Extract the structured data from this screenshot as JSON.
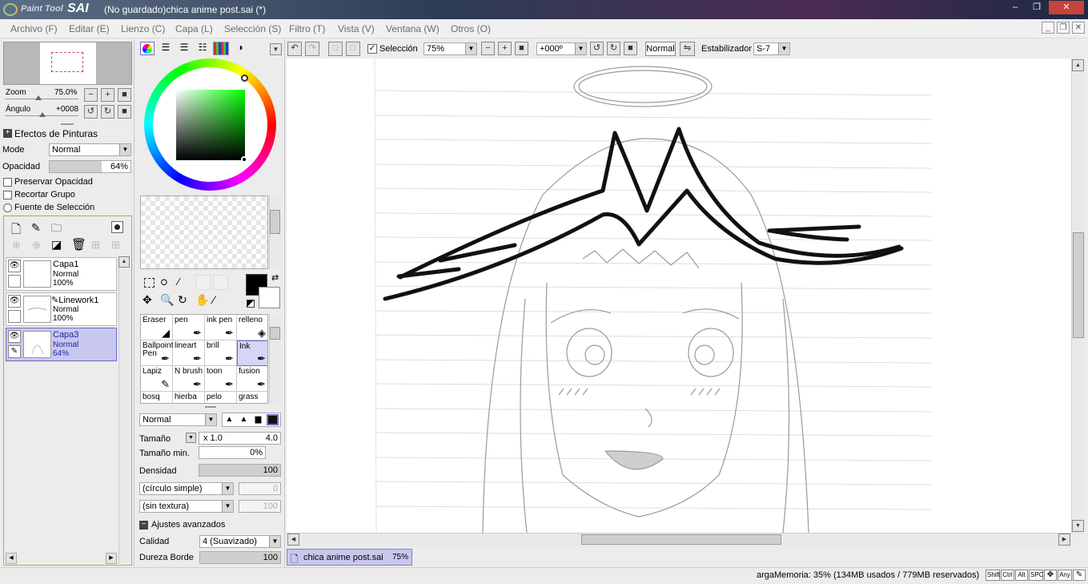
{
  "app": {
    "logo_small": "Paint Tool",
    "logo_big": "SAI",
    "title": "(No guardado)chica anime post.sai (*)"
  },
  "window_controls": {
    "minimize": "–",
    "restore": "❐",
    "close": "✕"
  },
  "menu": [
    "Archivo (F)",
    "Editar (E)",
    "Lienzo (C)",
    "Capa (L)",
    "Selección (S)",
    "Filtro (T)",
    "Vista (V)",
    "Ventana (W)",
    "Otros (O)"
  ],
  "mdi_controls": [
    "_",
    "❐",
    "✕"
  ],
  "navigator": {
    "zoom_label": "Zoom",
    "zoom_value": "75.0%",
    "angle_label": "Ángulo",
    "angle_value": "+0008"
  },
  "paint_effects": {
    "header": "Efectos de Pinturas",
    "mode_label": "Mode",
    "mode_value": "Normal",
    "opacity_label": "Opacidad",
    "opacity_value": "64%",
    "opacity_fraction": 0.64,
    "preserve_opacity": "Preservar Opacidad",
    "clip_group": "Recortar Grupo",
    "selection_source": "Fuente de Selección"
  },
  "layers": [
    {
      "name": "Capa1",
      "mode": "Normal",
      "opacity": "100%",
      "selected": false,
      "icon": ""
    },
    {
      "name": "Linework1",
      "mode": "Normal",
      "opacity": "100%",
      "selected": false,
      "icon": "✎"
    },
    {
      "name": "Capa3",
      "mode": "Normal",
      "opacity": "64%",
      "selected": true,
      "icon": ""
    }
  ],
  "color": {
    "foreground": "#000000",
    "background": "#ffffff",
    "accent_selected": "#c8c8ee"
  },
  "tools": [
    {
      "label": "Eraser",
      "icon": "eraser-icon",
      "glyph": "◢"
    },
    {
      "label": "pen",
      "icon": "pen-icon",
      "glyph": "✒"
    },
    {
      "label": "ink pen",
      "icon": "pen-icon",
      "glyph": "✒"
    },
    {
      "label": "relleno",
      "icon": "bucket-icon",
      "glyph": "◈"
    },
    {
      "label": "Ballpoint Pen",
      "icon": "pen-icon",
      "glyph": "✒"
    },
    {
      "label": "lineart",
      "icon": "pen-icon",
      "glyph": "✒"
    },
    {
      "label": "brill",
      "icon": "pen-icon",
      "glyph": "✒"
    },
    {
      "label": "Ink",
      "icon": "pen-icon",
      "glyph": "✒",
      "selected": true
    },
    {
      "label": "Lapiz",
      "icon": "pencil-icon",
      "glyph": "✎"
    },
    {
      "label": "N brush",
      "icon": "brush-icon",
      "glyph": "✒"
    },
    {
      "label": "toon",
      "icon": "brush-icon",
      "glyph": "✒"
    },
    {
      "label": "fusion",
      "icon": "brush-icon",
      "glyph": "✒"
    },
    {
      "label": "bosq",
      "icon": "brush-icon",
      "glyph": ""
    },
    {
      "label": "hierba",
      "icon": "brush-icon",
      "glyph": ""
    },
    {
      "label": "pelo",
      "icon": "brush-icon",
      "glyph": ""
    },
    {
      "label": "grass",
      "icon": "brush-icon",
      "glyph": ""
    }
  ],
  "brush": {
    "blend_mode": "Normal",
    "size_label": "Tamaño",
    "size_mult": "x 1.0",
    "size_value": "4.0",
    "min_size_label": "Tamaño min.",
    "min_size_value": "0%",
    "density_label": "Densidad",
    "density_value": "100",
    "shape": "(círculo simple)",
    "shape_value": "0",
    "texture": "(sin textura)",
    "texture_value": "100",
    "advanced_header": "Ajustes avanzados",
    "quality_label": "Calidad",
    "quality_value": "4 (Suavizado)",
    "edge_label": "Dureza Borde",
    "edge_value": "100"
  },
  "toolbar": {
    "selection_label": "Selección",
    "zoom_value": "75%",
    "angle_value": "+000º",
    "blend_value": "Normal",
    "stabilizer_label": "Estabilizador",
    "stabilizer_value": "S-7"
  },
  "tab": {
    "name": "chica anime post.sai",
    "zoom": "75%"
  },
  "status": {
    "memory": "argaMemoria: 35% (134MB usados / 779MB reservados)",
    "keys": [
      "Shift",
      "Ctrl",
      "Alt",
      "SPC",
      "✥",
      "Any",
      "✎"
    ]
  }
}
